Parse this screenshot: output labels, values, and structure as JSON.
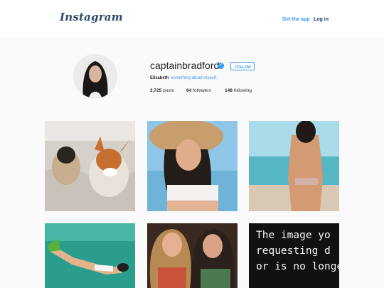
{
  "header": {
    "logo_text": "Instagram",
    "get_app_label": "Get the app",
    "login_label": "Log in"
  },
  "profile": {
    "username": "captainbradford",
    "verified_icon": "verified-badge-icon",
    "follow_label": "FOLLOW",
    "full_name": "Elizabeth",
    "bio": "something about myself.",
    "posts_count": "2,725",
    "posts_label": "posts",
    "followers_count": "64",
    "followers_label": "followers",
    "following_count": "148",
    "following_label": "following"
  },
  "grid": {
    "broken_image_lines": [
      "The image yo",
      "requesting d",
      "or is no longe"
    ]
  },
  "colors": {
    "accent": "#3897f0",
    "logo": "#2d4a6b",
    "login": "#1a3a66"
  }
}
